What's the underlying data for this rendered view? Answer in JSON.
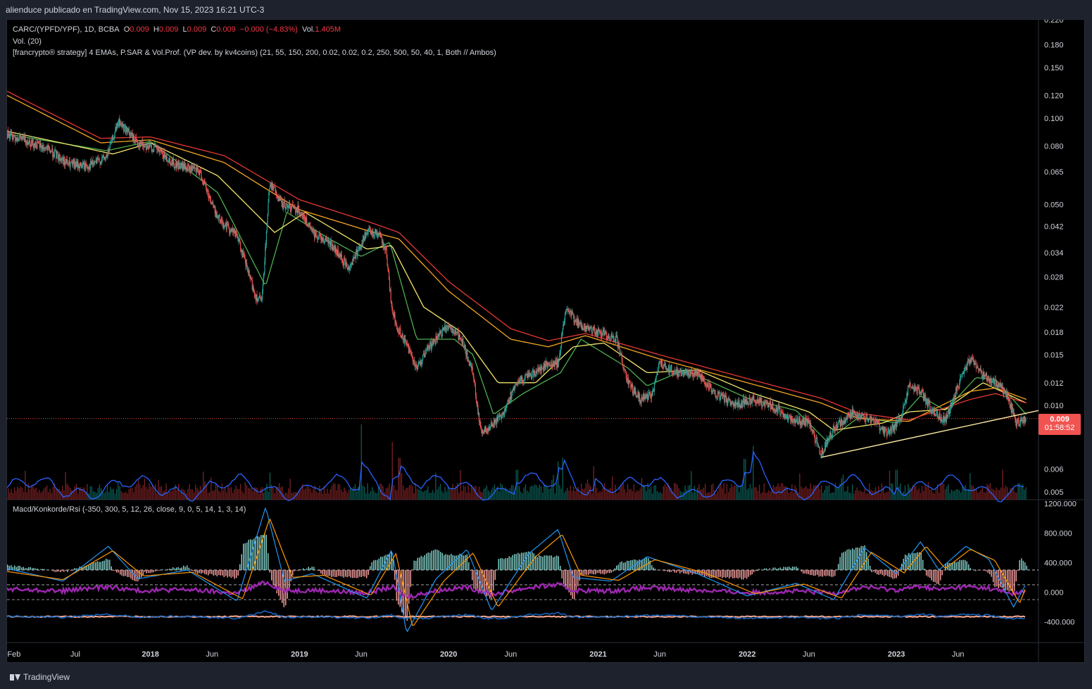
{
  "header": {
    "published": "alienduce publicado en TradingView.com, Nov 15, 2023 16:21 UTC-3"
  },
  "legend": {
    "symbol": "CARC/(YPFD/YPF), 1D, BCBA",
    "o_label": "O",
    "o_value": "0.009",
    "h_label": "H",
    "h_value": "0.009",
    "l_label": "L",
    "l_value": "0.009",
    "c_label": "C",
    "c_value": "0.009",
    "change": "−0.000 (−4.83%)",
    "vol_label": "Vol.",
    "vol_value": "1.405M",
    "volume_indicator": "Vol. (20)",
    "strategy": "[francrypto® strategy] 4 EMAs, P.SAR & Vol.Prof. (VP dev. by kv4coins) (21, 55, 150, 200, 0.02, 0.02, 0.2, 250, 500, 50, 40, 1, Both // Ambos)",
    "oscillator": "Macd/Konkorde/Rsi (-350, 300, 5, 12, 26, close, 9, 0, 5, 14, 1, 3, 14)"
  },
  "price_tag": {
    "price": "0.009",
    "countdown": "01:58:52"
  },
  "footer": {
    "brand": "TradingView"
  },
  "colors": {
    "up": "#26a69a",
    "down": "#ef5350",
    "ema21": "#4caf50",
    "ema55": "#f2e66b",
    "ema150": "#f5a623",
    "ema200": "#e53935",
    "vol_ma": "#2962ff",
    "trendline": "#f8e9a1",
    "rsi": "#9c27b0",
    "macd": "#2196f3",
    "signal": "#ff9800"
  },
  "chart_data": {
    "type": "line",
    "scale": "log",
    "x_ticks": [
      "Feb",
      "Jul",
      "2018",
      "Jun",
      "2019",
      "Jun",
      "2020",
      "Jun",
      "2021",
      "Jun",
      "2022",
      "Jun",
      "2023",
      "Jun"
    ],
    "x_tick_dates": [
      "2017-02-01",
      "2017-07-01",
      "2018-01-01",
      "2018-06-01",
      "2019-01-01",
      "2019-06-01",
      "2020-01-01",
      "2020-06-01",
      "2021-01-01",
      "2021-06-01",
      "2022-01-01",
      "2022-06-01",
      "2023-01-01",
      "2023-06-01"
    ],
    "x_range": [
      "2017-01-15",
      "2023-12-15"
    ],
    "price_ticks": [
      "0.220",
      "0.180",
      "0.150",
      "0.120",
      "0.100",
      "0.080",
      "0.065",
      "0.050",
      "0.042",
      "0.034",
      "0.028",
      "0.022",
      "0.018",
      "0.015",
      "0.012",
      "0.010",
      "0.006",
      "0.005"
    ],
    "ylim": [
      0.0047,
      0.22
    ],
    "price_series": {
      "name": "CARC/(YPFD/YPF)",
      "x": [
        "2017-01-15",
        "2017-03-01",
        "2017-05-01",
        "2017-06-15",
        "2017-08-01",
        "2017-09-15",
        "2017-10-15",
        "2017-12-01",
        "2018-01-15",
        "2018-03-01",
        "2018-04-01",
        "2018-05-01",
        "2018-06-15",
        "2018-08-01",
        "2018-09-15",
        "2018-10-01",
        "2018-10-20",
        "2018-11-20",
        "2019-01-01",
        "2019-02-01",
        "2019-03-15",
        "2019-05-01",
        "2019-06-15",
        "2019-07-15",
        "2019-08-01",
        "2019-08-15",
        "2019-08-25",
        "2019-09-15",
        "2019-10-15",
        "2019-11-15",
        "2020-01-01",
        "2020-02-01",
        "2020-03-01",
        "2020-03-20",
        "2020-04-15",
        "2020-05-15",
        "2020-06-15",
        "2020-08-01",
        "2020-09-01",
        "2020-09-25",
        "2020-10-15",
        "2020-11-15",
        "2021-01-01",
        "2021-02-15",
        "2021-03-15",
        "2021-04-15",
        "2021-05-15",
        "2021-06-01",
        "2021-07-15",
        "2021-09-01",
        "2021-10-15",
        "2021-12-01",
        "2022-01-15",
        "2022-03-01",
        "2022-04-15",
        "2022-06-01",
        "2022-07-01",
        "2022-08-01",
        "2022-09-15",
        "2022-11-01",
        "2022-12-15",
        "2023-01-15",
        "2023-02-01",
        "2023-03-01",
        "2023-04-01",
        "2023-05-01",
        "2023-06-01",
        "2023-07-01",
        "2023-08-01",
        "2023-09-01",
        "2023-10-01",
        "2023-10-20",
        "2023-11-15"
      ],
      "values": [
        0.088,
        0.084,
        0.077,
        0.069,
        0.068,
        0.073,
        0.097,
        0.082,
        0.078,
        0.069,
        0.067,
        0.065,
        0.045,
        0.039,
        0.024,
        0.023,
        0.06,
        0.05,
        0.048,
        0.04,
        0.037,
        0.03,
        0.04,
        0.04,
        0.034,
        0.022,
        0.019,
        0.017,
        0.0135,
        0.016,
        0.019,
        0.017,
        0.013,
        0.008,
        0.0085,
        0.0095,
        0.012,
        0.013,
        0.014,
        0.014,
        0.022,
        0.019,
        0.018,
        0.017,
        0.012,
        0.0105,
        0.011,
        0.014,
        0.013,
        0.013,
        0.011,
        0.01,
        0.0105,
        0.01,
        0.009,
        0.0087,
        0.0068,
        0.0083,
        0.0094,
        0.0089,
        0.008,
        0.0093,
        0.0117,
        0.0112,
        0.0095,
        0.0088,
        0.0117,
        0.0145,
        0.0128,
        0.012,
        0.0108,
        0.0087,
        0.009
      ]
    },
    "ema_series": [
      {
        "key": "ema21",
        "x": [
          "2017-01-15",
          "2017-09-15",
          "2018-01-01",
          "2018-06-15",
          "2018-10-10",
          "2018-12-01",
          "2019-03-15",
          "2019-06-01",
          "2019-08-10",
          "2019-10-15",
          "2020-01-15",
          "2020-03-01",
          "2020-04-20",
          "2020-07-01",
          "2020-10-01",
          "2020-11-20",
          "2021-03-15",
          "2021-05-01",
          "2021-08-01",
          "2022-01-01",
          "2022-05-01",
          "2022-07-15",
          "2022-10-01",
          "2023-01-01",
          "2023-03-01",
          "2023-05-01",
          "2023-07-15",
          "2023-09-01",
          "2023-11-15"
        ],
        "values": [
          0.088,
          0.077,
          0.083,
          0.055,
          0.026,
          0.047,
          0.038,
          0.033,
          0.037,
          0.017,
          0.017,
          0.015,
          0.0093,
          0.011,
          0.013,
          0.017,
          0.0135,
          0.0117,
          0.0133,
          0.0106,
          0.0096,
          0.0075,
          0.0091,
          0.0087,
          0.0108,
          0.0096,
          0.0125,
          0.0123,
          0.0093
        ]
      },
      {
        "key": "ema55",
        "x": [
          "2017-01-15",
          "2017-10-01",
          "2018-01-01",
          "2018-06-15",
          "2018-11-01",
          "2019-01-15",
          "2019-06-15",
          "2019-08-15",
          "2019-11-01",
          "2020-02-01",
          "2020-05-01",
          "2020-08-01",
          "2020-11-01",
          "2021-01-15",
          "2021-05-01",
          "2021-09-01",
          "2022-01-01",
          "2022-06-01",
          "2022-08-01",
          "2022-12-01",
          "2023-02-01",
          "2023-05-01",
          "2023-08-01",
          "2023-11-15"
        ],
        "values": [
          0.09,
          0.075,
          0.082,
          0.063,
          0.04,
          0.047,
          0.035,
          0.036,
          0.022,
          0.018,
          0.012,
          0.012,
          0.016,
          0.0165,
          0.013,
          0.0133,
          0.0112,
          0.0095,
          0.0082,
          0.0087,
          0.0095,
          0.0097,
          0.012,
          0.0102
        ]
      },
      {
        "key": "ema150",
        "x": [
          "2017-01-15",
          "2017-09-01",
          "2018-01-01",
          "2018-07-01",
          "2019-01-01",
          "2019-07-01",
          "2019-09-01",
          "2020-01-01",
          "2020-06-01",
          "2020-09-01",
          "2020-12-01",
          "2021-06-01",
          "2022-01-01",
          "2022-07-01",
          "2022-10-01",
          "2023-02-01",
          "2023-07-01",
          "2023-09-01",
          "2023-11-15"
        ],
        "values": [
          0.12,
          0.082,
          0.084,
          0.07,
          0.048,
          0.04,
          0.038,
          0.025,
          0.017,
          0.016,
          0.0175,
          0.0145,
          0.012,
          0.0102,
          0.009,
          0.0088,
          0.0112,
          0.0115,
          0.0105
        ]
      },
      {
        "key": "ema200",
        "x": [
          "2017-01-15",
          "2017-09-01",
          "2018-01-01",
          "2018-07-01",
          "2019-01-01",
          "2019-07-01",
          "2019-09-01",
          "2020-01-01",
          "2020-06-01",
          "2020-09-01",
          "2020-12-01",
          "2021-06-01",
          "2022-01-01",
          "2022-07-01",
          "2022-10-01",
          "2023-02-01",
          "2023-07-01",
          "2023-09-01",
          "2023-11-15"
        ],
        "values": [
          0.124,
          0.085,
          0.086,
          0.074,
          0.052,
          0.043,
          0.04,
          0.027,
          0.0185,
          0.0168,
          0.0178,
          0.015,
          0.0124,
          0.0106,
          0.0094,
          0.0089,
          0.0105,
          0.011,
          0.0102
        ]
      }
    ],
    "trendline": {
      "x": [
        "2022-07-01",
        "2023-12-15"
      ],
      "values": [
        0.0066,
        0.0096
      ]
    },
    "current_price_line": 0.009,
    "volume": {
      "spikes": [
        {
          "x": "2019-06-01",
          "level": 0.63
        },
        {
          "x": "2019-08-15",
          "level": 0.48
        },
        {
          "x": "2019-09-01",
          "level": 0.35
        },
        {
          "x": "2020-06-15",
          "level": 0.25
        },
        {
          "x": "2020-09-25",
          "level": 0.32
        },
        {
          "x": "2020-10-05",
          "level": 0.35
        },
        {
          "x": "2020-12-20",
          "level": 0.28
        },
        {
          "x": "2021-12-25",
          "level": 0.34
        },
        {
          "x": "2022-01-15",
          "level": 0.45
        },
        {
          "x": "2023-01-01",
          "level": 0.25
        }
      ]
    },
    "oscillator": {
      "ticks": [
        "1200.000",
        "800.000",
        "400.000",
        "0.000",
        "-400.000"
      ],
      "tick_values": [
        1200,
        800,
        400,
        0,
        -400
      ],
      "ylim": [
        -680,
        1250
      ],
      "macd": {
        "x": [
          "2017-01-15",
          "2017-06-01",
          "2017-09-20",
          "2017-12-01",
          "2018-04-01",
          "2018-08-01",
          "2018-10-10",
          "2018-11-25",
          "2019-02-01",
          "2019-06-15",
          "2019-08-15",
          "2019-09-20",
          "2019-12-01",
          "2020-02-15",
          "2020-04-15",
          "2020-07-15",
          "2020-09-25",
          "2020-11-01",
          "2021-02-01",
          "2021-05-01",
          "2021-09-01",
          "2022-01-01",
          "2022-05-01",
          "2022-08-01",
          "2022-10-15",
          "2023-01-01",
          "2023-03-01",
          "2023-04-15",
          "2023-06-20",
          "2023-08-15",
          "2023-10-15",
          "2023-11-15"
        ],
        "values": [
          320,
          150,
          620,
          180,
          300,
          -120,
          1150,
          150,
          250,
          -80,
          580,
          -550,
          180,
          580,
          -250,
          520,
          850,
          200,
          150,
          480,
          250,
          -50,
          120,
          -100,
          600,
          250,
          680,
          300,
          620,
          450,
          -200,
          120
        ]
      },
      "signal": {
        "x": [
          "2017-01-15",
          "2017-06-01",
          "2017-10-01",
          "2017-12-15",
          "2018-04-15",
          "2018-08-15",
          "2018-10-20",
          "2018-12-15",
          "2019-03-01",
          "2019-06-25",
          "2019-08-25",
          "2019-10-05",
          "2019-12-20",
          "2020-03-01",
          "2020-05-01",
          "2020-08-01",
          "2020-10-05",
          "2020-11-20",
          "2021-02-20",
          "2021-05-20",
          "2021-09-20",
          "2022-01-20",
          "2022-05-20",
          "2022-08-20",
          "2022-11-01",
          "2023-01-20",
          "2023-03-15",
          "2023-05-01",
          "2023-07-01",
          "2023-08-30",
          "2023-10-30",
          "2023-11-15"
        ],
        "values": [
          280,
          170,
          560,
          220,
          270,
          -90,
          1000,
          200,
          230,
          -40,
          520,
          -470,
          150,
          530,
          -200,
          480,
          780,
          230,
          160,
          440,
          260,
          -20,
          110,
          -80,
          540,
          260,
          620,
          320,
          580,
          430,
          -150,
          80
        ]
      }
    }
  }
}
